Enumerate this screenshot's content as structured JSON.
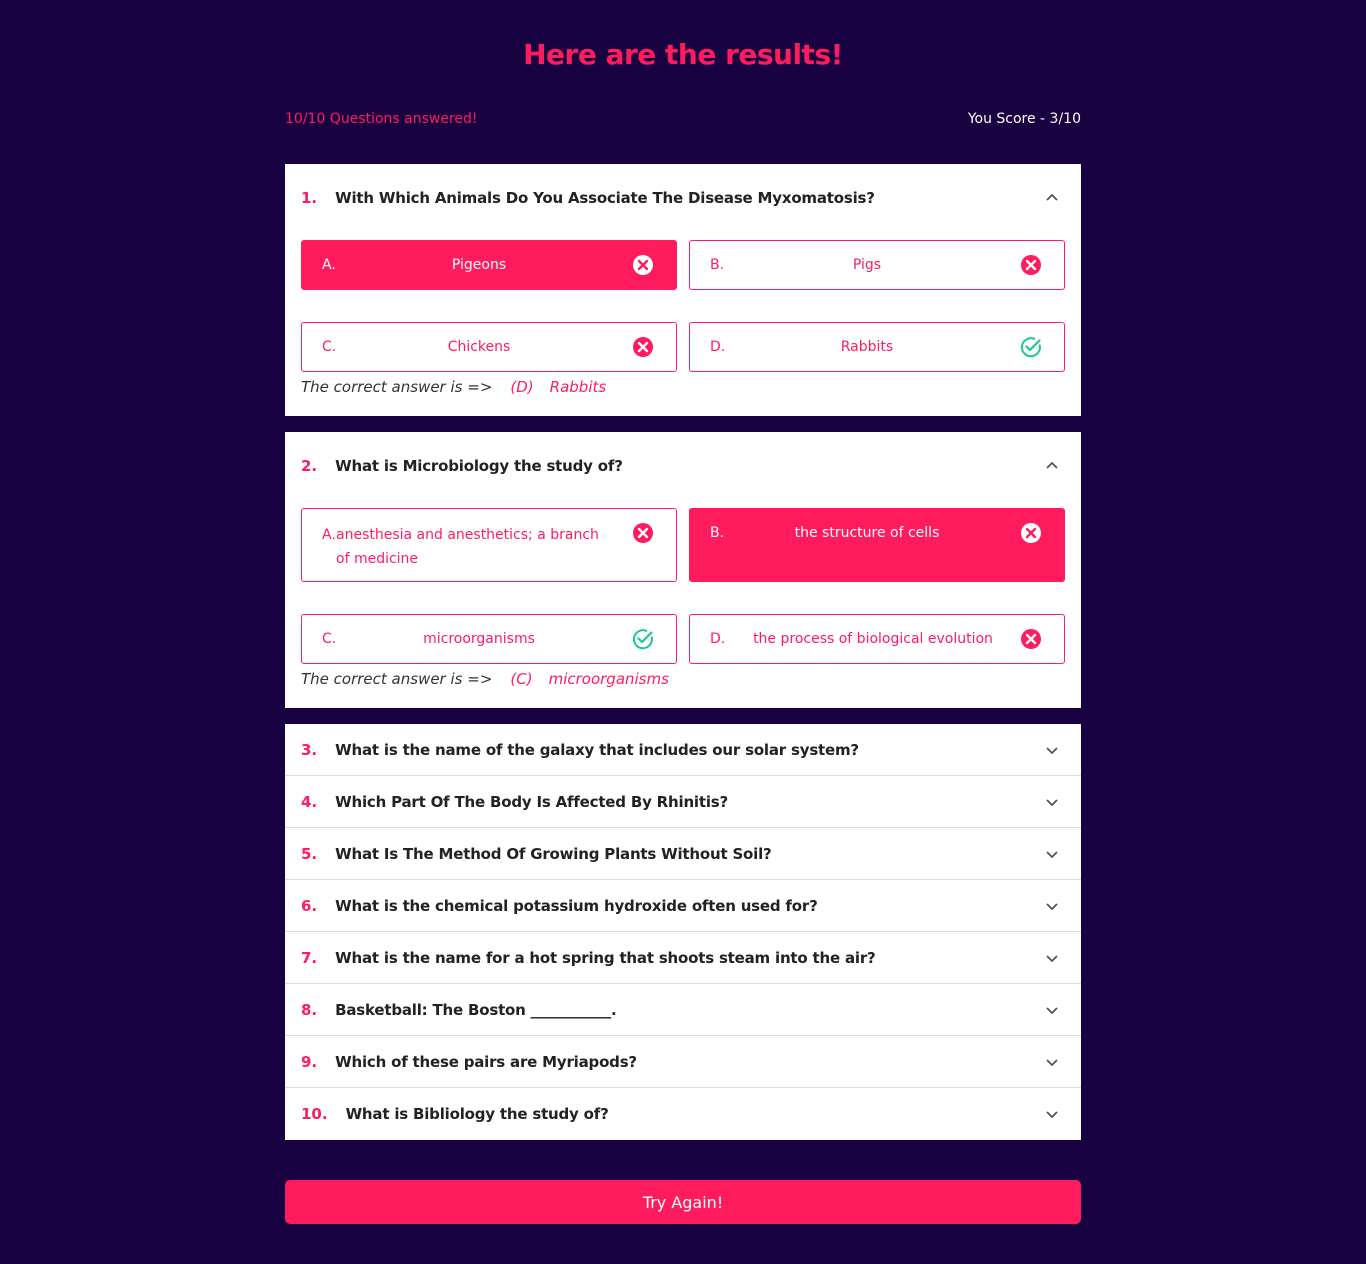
{
  "header": {
    "title": "Here are the results!",
    "answered": "10/10 Questions answered!",
    "score": "You Score - 3/10"
  },
  "colors": {
    "background": "#180241",
    "accent": "#ff1b5e",
    "correct": "#1ec98a"
  },
  "correct_prefix": "The correct answer is =>",
  "expanded": [
    {
      "num": "1.",
      "text": "With Which Animals Do You Associate The Disease Myxomatosis?",
      "options": [
        {
          "letter": "A.",
          "label": "Pigeons",
          "selected": true,
          "status": "x-circle-icon"
        },
        {
          "letter": "B.",
          "label": "Pigs",
          "selected": false,
          "status": "x-circle-icon"
        },
        {
          "letter": "C.",
          "label": "Chickens",
          "selected": false,
          "status": "x-circle-icon"
        },
        {
          "letter": "D.",
          "label": "Rabbits",
          "selected": false,
          "status": "check-circle-icon"
        }
      ],
      "correct_letter": "(D)",
      "correct_answer": "Rabbits"
    },
    {
      "num": "2.",
      "text": "What is Microbiology the study of?",
      "options": [
        {
          "letter": "A.",
          "label": "anesthesia and anesthetics; a branch of medicine",
          "selected": false,
          "status": "x-circle-icon"
        },
        {
          "letter": "B.",
          "label": "the structure of cells",
          "selected": true,
          "status": "x-circle-icon"
        },
        {
          "letter": "C.",
          "label": "microorganisms",
          "selected": false,
          "status": "check-circle-icon"
        },
        {
          "letter": "D.",
          "label": "the process of biological evolution",
          "selected": false,
          "status": "x-circle-icon"
        }
      ],
      "correct_letter": "(C)",
      "correct_answer": "microorganisms"
    }
  ],
  "collapsed": [
    {
      "num": "3.",
      "text": "What is the name of the galaxy that includes our solar system?"
    },
    {
      "num": "4.",
      "text": "Which Part Of The Body Is Affected By Rhinitis?"
    },
    {
      "num": "5.",
      "text": "What Is The Method Of Growing Plants Without Soil?"
    },
    {
      "num": "6.",
      "text": "What is the chemical potassium hydroxide often used for?"
    },
    {
      "num": "7.",
      "text": "What is the name for a hot spring that shoots steam into the air?"
    },
    {
      "num": "8.",
      "text": "Basketball: The Boston ___________."
    },
    {
      "num": "9.",
      "text": "Which of these pairs are Myriapods?"
    },
    {
      "num": "10.",
      "text": "What is Bibliology the study of?"
    }
  ],
  "try_again": "Try Again!"
}
